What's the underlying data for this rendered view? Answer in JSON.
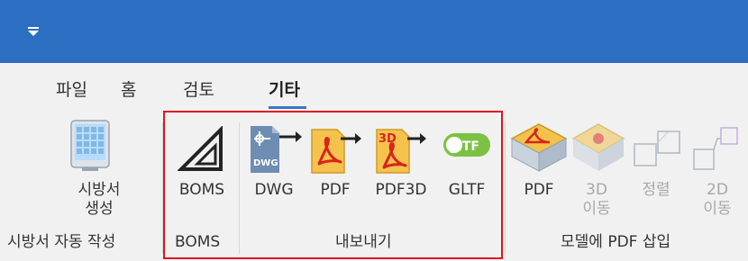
{
  "quick_access": {
    "icon": "dropdown-arrow-icon"
  },
  "colors": {
    "titlebar": "#2c6fc2",
    "highlight_border": "#e0141e",
    "tab_underline": "#3a78c4"
  },
  "tabs": [
    {
      "label": "파일"
    },
    {
      "label": "홈"
    },
    {
      "label": "검토"
    },
    {
      "label": "기타",
      "active": true
    }
  ],
  "groups": {
    "spec": {
      "label": "시방서 자동 작성",
      "buttons": [
        {
          "label_line1": "시방서",
          "label_line2": "생성",
          "icon": "spec-document-icon"
        }
      ]
    },
    "boms": {
      "label": "BOMS",
      "buttons": [
        {
          "label": "BOMS",
          "icon": "triangle-ruler-icon"
        }
      ]
    },
    "export": {
      "label": "내보내기",
      "buttons": [
        {
          "label": "DWG",
          "icon": "dwg-export-icon",
          "icon_text": "DWG"
        },
        {
          "label": "PDF",
          "icon": "pdf-export-icon"
        },
        {
          "label": "PDF3D",
          "icon": "pdf3d-export-icon",
          "icon_text": "3D"
        },
        {
          "label": "GLTF",
          "icon": "gltf-export-icon",
          "icon_text": "glTF"
        }
      ]
    },
    "insert_pdf": {
      "label": "모델에 PDF 삽입",
      "buttons": [
        {
          "label": "PDF",
          "icon": "pdf-insert-icon",
          "enabled": true
        },
        {
          "label_line1": "3D",
          "label_line2": "이동",
          "icon": "move-3d-icon",
          "enabled": false
        },
        {
          "label": "정렬",
          "icon": "align-icon",
          "enabled": false
        },
        {
          "label_line1": "2D",
          "label_line2": "이동",
          "icon": "move-2d-icon",
          "enabled": false
        }
      ]
    }
  }
}
